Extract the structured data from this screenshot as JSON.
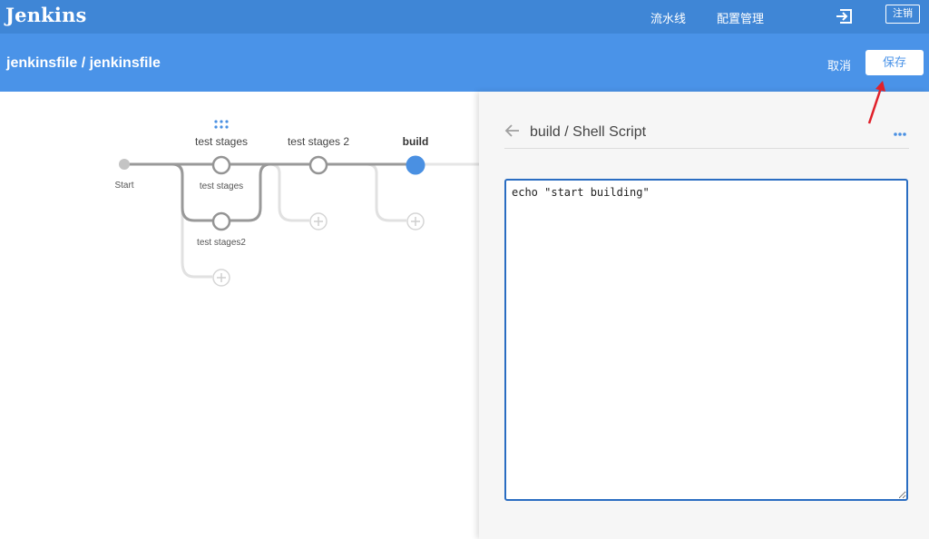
{
  "app": {
    "logo": "Jenkins"
  },
  "topnav": {
    "pipelines": "流水线",
    "config": "配置管理",
    "logout": "注销"
  },
  "header": {
    "title": "jenkinsfile / jenkinsfile",
    "cancel": "取消",
    "save": "保存"
  },
  "graph": {
    "start_label": "Start",
    "stages": [
      {
        "label": "test stages",
        "branches": [
          "test stages",
          "test stages2"
        ]
      },
      {
        "label": "test stages 2"
      },
      {
        "label": "build",
        "selected": true
      }
    ]
  },
  "panel": {
    "title": "build / Shell Script",
    "script": "echo \"start building\""
  },
  "colors": {
    "topbar": "#3f86d6",
    "subheader": "#4a93e8",
    "accent": "#4a90e2",
    "annotation": "#e0202a"
  },
  "icons": {
    "exit": "exit-icon",
    "back": "back-arrow-icon",
    "more": "more-icon",
    "add": "add-stage-icon"
  }
}
